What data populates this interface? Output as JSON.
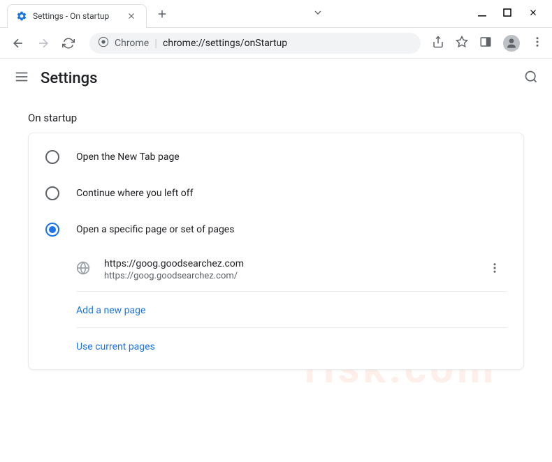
{
  "window": {
    "tab_title": "Settings - On startup"
  },
  "toolbar": {
    "chrome_label": "Chrome",
    "url": "chrome://settings/onStartup"
  },
  "header": {
    "title": "Settings"
  },
  "section": {
    "title": "On startup",
    "options": [
      {
        "label": "Open the New Tab page",
        "selected": false
      },
      {
        "label": "Continue where you left off",
        "selected": false
      },
      {
        "label": "Open a specific page or set of pages",
        "selected": true
      }
    ],
    "pages": [
      {
        "title": "https://goog.goodsearchez.com",
        "url": "https://goog.goodsearchez.com/"
      }
    ],
    "add_page_label": "Add a new page",
    "use_current_label": "Use current pages"
  }
}
